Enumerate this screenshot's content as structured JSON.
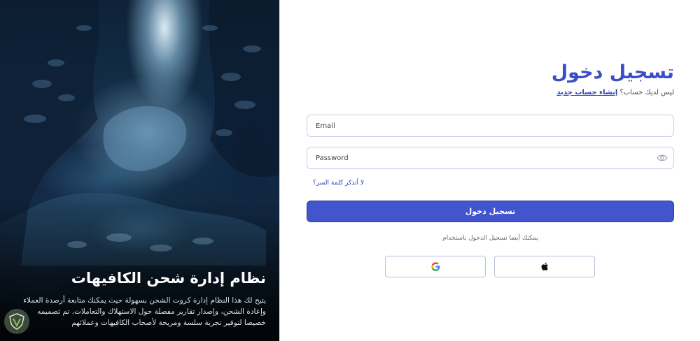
{
  "hero": {
    "title": "نظام إدارة شحن الكافيهات",
    "description": "يتيح لك هذا النظام إدارة كروت الشحن بسهولة حيث يمكنك متابعة أرصدة العملاء وإعادة الشحن، وإصدار تقارير مفصلة حول الاستهلاك والتعاملات. تم تصميمه خصيصا لتوفير تجربة سلسة ومريحة لأصحاب الكافيهات وعملائهم"
  },
  "login": {
    "title": "تسجيل دخول",
    "no_account": "ليس لديك حساب؟",
    "create_account": "إنشاء حساب جديد",
    "email_placeholder": "Email",
    "password_placeholder": "Password",
    "forgot_password": "لا أتذكر كلمة السر؟",
    "submit_label": "تسجيل دخول",
    "alt_login_text": "يمكنك أيضا تسجيل الدخول باستخدام",
    "social": [
      {
        "icon": "apple-icon"
      },
      {
        "icon": "google-icon"
      }
    ]
  },
  "colors": {
    "accent": "#4355cc",
    "title": "#3c4dc8",
    "link": "#2b3fb6"
  }
}
